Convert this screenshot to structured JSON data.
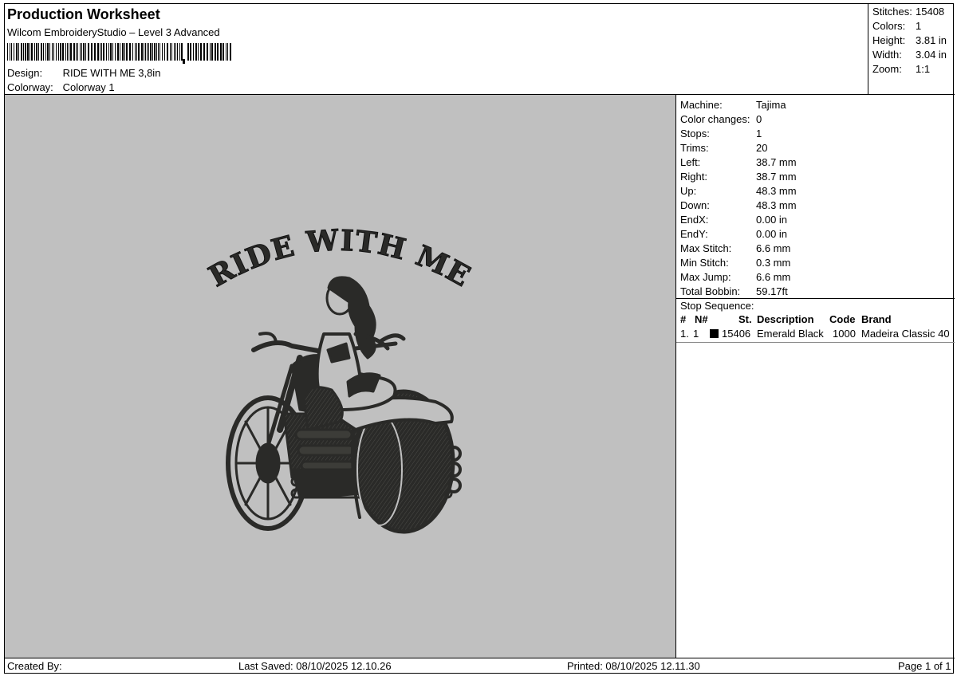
{
  "header": {
    "title": "Production Worksheet",
    "software": "Wilcom EmbroideryStudio – Level 3 Advanced",
    "design_label": "Design:",
    "design_value": "RIDE WITH ME 3,8in",
    "colorway_label": "Colorway:",
    "colorway_value": "Colorway 1"
  },
  "summary": [
    {
      "label": "Stitches:",
      "value": "15408"
    },
    {
      "label": "Colors:",
      "value": "1"
    },
    {
      "label": "Height:",
      "value": "3.81 in"
    },
    {
      "label": "Width:",
      "value": "3.04 in"
    },
    {
      "label": "Zoom:",
      "value": "1:1"
    }
  ],
  "design": {
    "text": "RIDE WITH ME",
    "thread_color": "#2a2a28",
    "background": "#c0c0c0"
  },
  "machine_info": [
    {
      "label": "Machine:",
      "value": "Tajima"
    },
    {
      "label": "Color changes:",
      "value": "0"
    },
    {
      "label": "Stops:",
      "value": "1"
    },
    {
      "label": "Trims:",
      "value": "20"
    },
    {
      "label": "Left:",
      "value": "38.7 mm"
    },
    {
      "label": "Right:",
      "value": "38.7 mm"
    },
    {
      "label": "Up:",
      "value": "48.3 mm"
    },
    {
      "label": "Down:",
      "value": "48.3 mm"
    },
    {
      "label": "EndX:",
      "value": "0.00 in"
    },
    {
      "label": "EndY:",
      "value": "0.00 in"
    },
    {
      "label": "Max Stitch:",
      "value": "6.6 mm"
    },
    {
      "label": "Min Stitch:",
      "value": "0.3 mm"
    },
    {
      "label": "Max Jump:",
      "value": "6.6 mm"
    },
    {
      "label": "Total Bobbin:",
      "value": "59.17ft"
    }
  ],
  "stop_sequence": {
    "title": "Stop Sequence:",
    "headers": {
      "num": "#",
      "n": "N#",
      "st": "St.",
      "description": "Description",
      "code": "Code",
      "brand": "Brand"
    },
    "rows": [
      {
        "num": "1.",
        "n": "1",
        "swatch": "#000000",
        "st": "15406",
        "description": "Emerald Black",
        "code": "1000",
        "brand": "Madeira Classic 40"
      }
    ]
  },
  "footer": {
    "created_by": "Created By:",
    "last_saved": "Last Saved: 08/10/2025 12.10.26",
    "printed": "Printed: 08/10/2025 12.11.30",
    "page": "Page 1 of 1"
  }
}
